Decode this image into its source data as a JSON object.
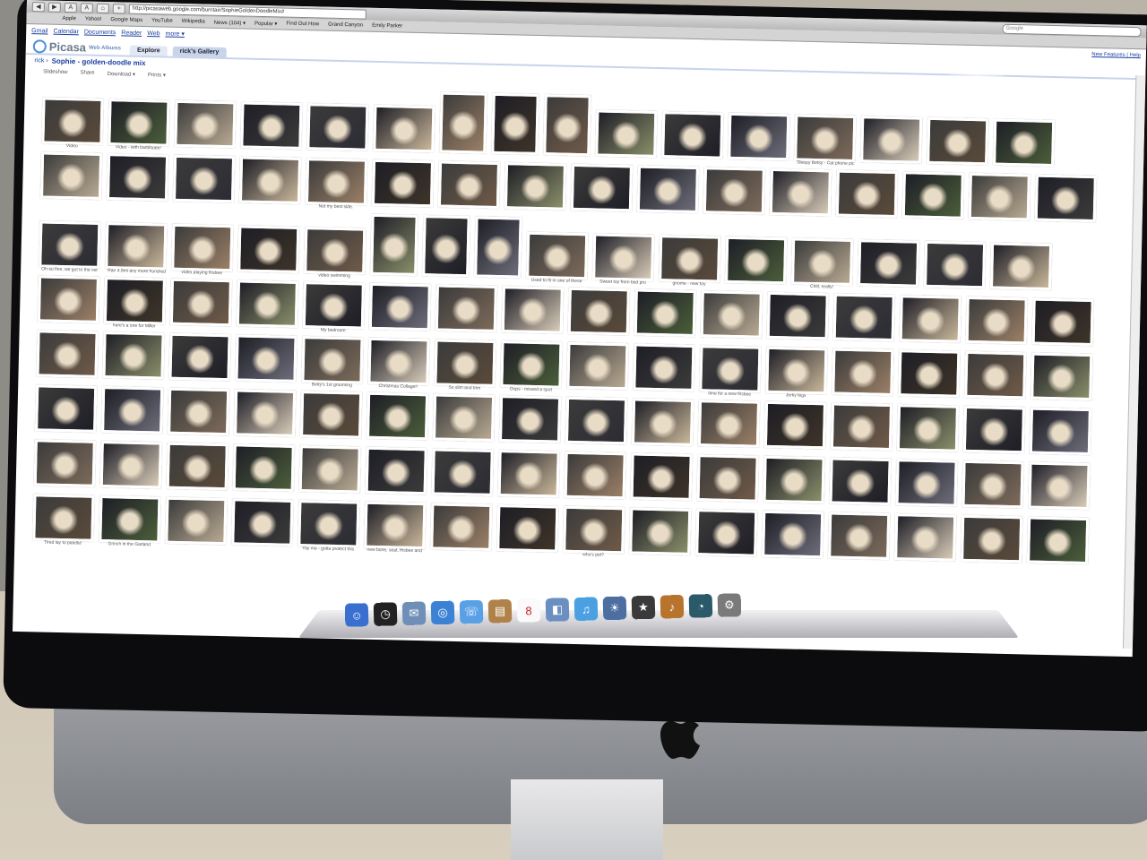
{
  "browser": {
    "url": "http://picasaweb.google.com/burntair/SophieGoldenDoodleMix#",
    "search_placeholder": "Google",
    "bookmarks": [
      "Apple",
      "Yahoo!",
      "Google Maps",
      "YouTube",
      "Wikipedia",
      "News (104) ▾",
      "Popular ▾",
      "Find Out How",
      "Grand Canyon",
      "Emily Parker"
    ]
  },
  "gbar": {
    "links": [
      "Gmail",
      "Calendar",
      "Documents",
      "Reader",
      "Web",
      "more ▾"
    ],
    "right": "New Features | Help"
  },
  "picasa": {
    "logo": "Picasa",
    "logo_sub": "Web Albums",
    "tabs": [
      "Explore",
      "rick's Gallery"
    ],
    "breadcrumb": "rick ›",
    "album_title": "Sophie - golden-doodle mix",
    "actions": [
      "Slideshow",
      "Share",
      "Download ▾",
      "Prints ▾"
    ]
  },
  "captions": {
    "r0": [
      "Video",
      "Video - with barbituate!",
      "",
      "",
      "",
      "",
      "",
      "",
      "",
      "",
      "",
      "",
      "Sleepy Betsy - Cat phone pic",
      "",
      "",
      "",
      ""
    ],
    "r1": [
      "",
      "",
      "",
      "",
      "Not my best side.",
      "",
      "",
      "",
      "",
      "",
      "",
      "",
      "",
      "",
      "",
      ""
    ],
    "r2": [
      "Oh-so fine, we got to the vet",
      "Ran 4.8mi any more hundred",
      "video playing frisbee",
      "",
      "video swimming",
      "",
      "",
      "",
      "Used to fit in one of these",
      "Sweet toy from bed pro",
      "gnome - new toy",
      "",
      "Chill, really!",
      "",
      ""
    ],
    "r3": [
      "",
      "here's a one for Miller",
      "",
      "",
      "My bedroom",
      "",
      "",
      "",
      "",
      "",
      "",
      "",
      "",
      "",
      "",
      ""
    ],
    "r4": [
      "",
      "",
      "",
      "",
      "Betty's 1st grooming",
      "Christmas Collage!!",
      "So slim and trim",
      "Oops - missed a spot",
      "",
      "",
      "time for a new frisbee",
      "Jerky legs",
      "",
      "",
      "",
      ""
    ],
    "r7": [
      "Tired lay to palette!",
      "Grinch in the Garland",
      "",
      "",
      "Yay me - gotta protect this",
      "new bone, seat, frisbee and",
      "",
      "",
      "who's pet?",
      "",
      "",
      "",
      "",
      "",
      "",
      ""
    ]
  },
  "dock": [
    "Finder",
    "Dashboard",
    "Mail",
    "Safari",
    "iChat",
    "Address Book",
    "iCal",
    "Preview",
    "iTunes",
    "iPhoto",
    "iMovie",
    "GarageBand",
    "Time Machine",
    "System Preferences"
  ],
  "colors": {
    "link": "#1a3fa0",
    "tab_bg": "#c7d4ea"
  }
}
